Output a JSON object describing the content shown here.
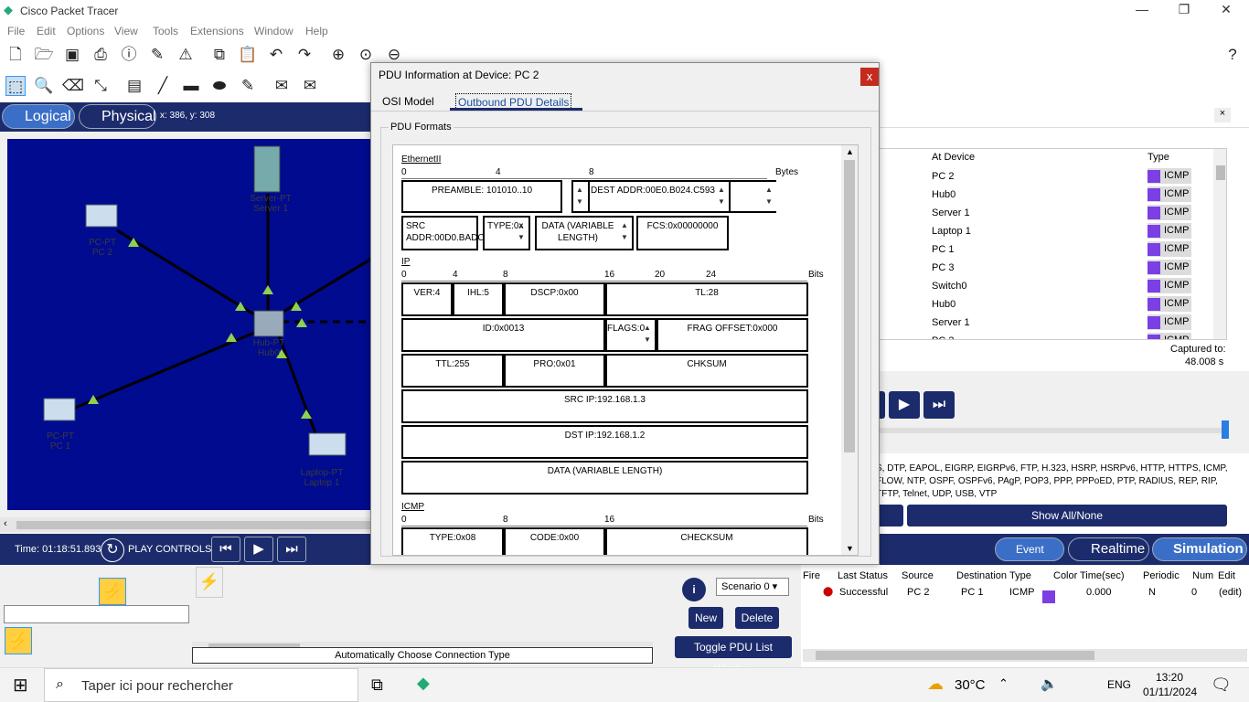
{
  "app": {
    "title": "Cisco Packet Tracer"
  },
  "menu": [
    "File",
    "Edit",
    "Options",
    "View",
    "Tools",
    "Extensions",
    "Window",
    "Help"
  ],
  "workspace": {
    "logical_label": "Logical",
    "physical_label": "Physical",
    "coords": "x: 386, y: 308"
  },
  "canvas_devices": {
    "server": "Server-PT\nServer 1",
    "pc2": "PC-PT\nPC 2",
    "hub": "Hub-PT\nHub0",
    "pc1": "PC-PT\nPC 1",
    "laptop": "Laptop-PT\nLaptop 1"
  },
  "dialog": {
    "title": "PDU Information at Device: PC 2",
    "close": "x",
    "tabs": [
      "OSI Model",
      "Outbound PDU Details"
    ],
    "section_title": "PDU Formats",
    "ethernet": {
      "label": "EthernetII",
      "ruler": [
        "0",
        "4",
        "8",
        "Bytes"
      ],
      "preamble": "PREAMBLE: 101010..10",
      "dest": "DEST ADDR:00E0.B024.C593",
      "src": "SRC ADDR:00D0.BADC.6062",
      "type": "TYPE:0x",
      "data": "DATA (VARIABLE LENGTH)",
      "fcs": "FCS:0x00000000"
    },
    "ip": {
      "label": "IP",
      "ruler": [
        "0",
        "4",
        "8",
        "16",
        "20",
        "24",
        "Bits"
      ],
      "ver": "VER:4",
      "ihl": "IHL:5",
      "dscp": "DSCP:0x00",
      "tl": "TL:28",
      "id": "ID:0x0013",
      "flags": "FLAGS:0",
      "frag": "FRAG OFFSET:0x000",
      "ttl": "TTL:255",
      "pro": "PRO:0x01",
      "chksum": "CHKSUM",
      "src": "SRC IP:192.168.1.3",
      "dst": "DST IP:192.168.1.2",
      "data": "DATA (VARIABLE LENGTH)"
    },
    "icmp": {
      "label": "ICMP",
      "ruler": [
        "0",
        "8",
        "16",
        "Bits"
      ],
      "type": "TYPE:0x08",
      "code": "CODE:0x00",
      "checksum": "CHECKSUM"
    }
  },
  "event_list": {
    "headers": {
      "at_device": "At Device",
      "type": "Type"
    },
    "rows": [
      {
        "device": "PC 2",
        "type": "ICMP"
      },
      {
        "device": "Hub0",
        "type": "ICMP"
      },
      {
        "device": "Server 1",
        "type": "ICMP"
      },
      {
        "device": "Laptop 1",
        "type": "ICMP"
      },
      {
        "device": "PC 1",
        "type": "ICMP"
      },
      {
        "device": "PC 3",
        "type": "ICMP"
      },
      {
        "device": "Switch0",
        "type": "ICMP"
      },
      {
        "device": "Hub0",
        "type": "ICMP"
      },
      {
        "device": "Server 1",
        "type": "ICMP"
      },
      {
        "device": "PC 3",
        "type": "ICMP"
      }
    ],
    "captured_label": "Captured to:",
    "captured_value": "48.008 s",
    "protocols": "S, DTP, EAPOL, EIGRP, EIGRPv6, FTP, H.323, HSRP, HSRPv6, HTTP, HTTPS, ICMP,\nFLOW, NTP, OSPF, OSPFv6, PAgP, POP3, PPP, PPPoED, PTP, RADIUS, REP, RIP,\nTFTP, Telnet, UDP, USB, VTP",
    "show_all": "Show All/None"
  },
  "status": {
    "time": "Time: 01:18:51.893",
    "play_controls": "PLAY CONTROLS:",
    "event_list_btn": "Event List",
    "realtime": "Realtime",
    "simulation": "Simulation"
  },
  "connections": {
    "auto_label": "Automatically Choose Connection Type"
  },
  "scenario": {
    "select": "Scenario 0",
    "new": "New",
    "delete": "Delete",
    "toggle": "Toggle PDU List Window"
  },
  "pdu_list": {
    "headers": [
      "Fire",
      "Last Status",
      "Source",
      "Destination",
      "Type",
      "Color",
      "Time(sec)",
      "Periodic",
      "Num",
      "Edit"
    ],
    "row": {
      "status": "Successful",
      "source": "PC 2",
      "destination": "PC 1",
      "type": "ICMP",
      "time": "0.000",
      "periodic": "N",
      "num": "0",
      "edit": "(edit)"
    },
    "color": "#7b3fe4"
  },
  "taskbar": {
    "search_placeholder": "Taper ici pour rechercher",
    "weather": "30°C",
    "lang": "ENG",
    "time": "13:20",
    "date": "01/11/2024"
  },
  "colors": {
    "navy": "#1c2b6b",
    "canvas": "#000b8f",
    "accent": "#3b6fc7",
    "close": "#c42b1c"
  }
}
